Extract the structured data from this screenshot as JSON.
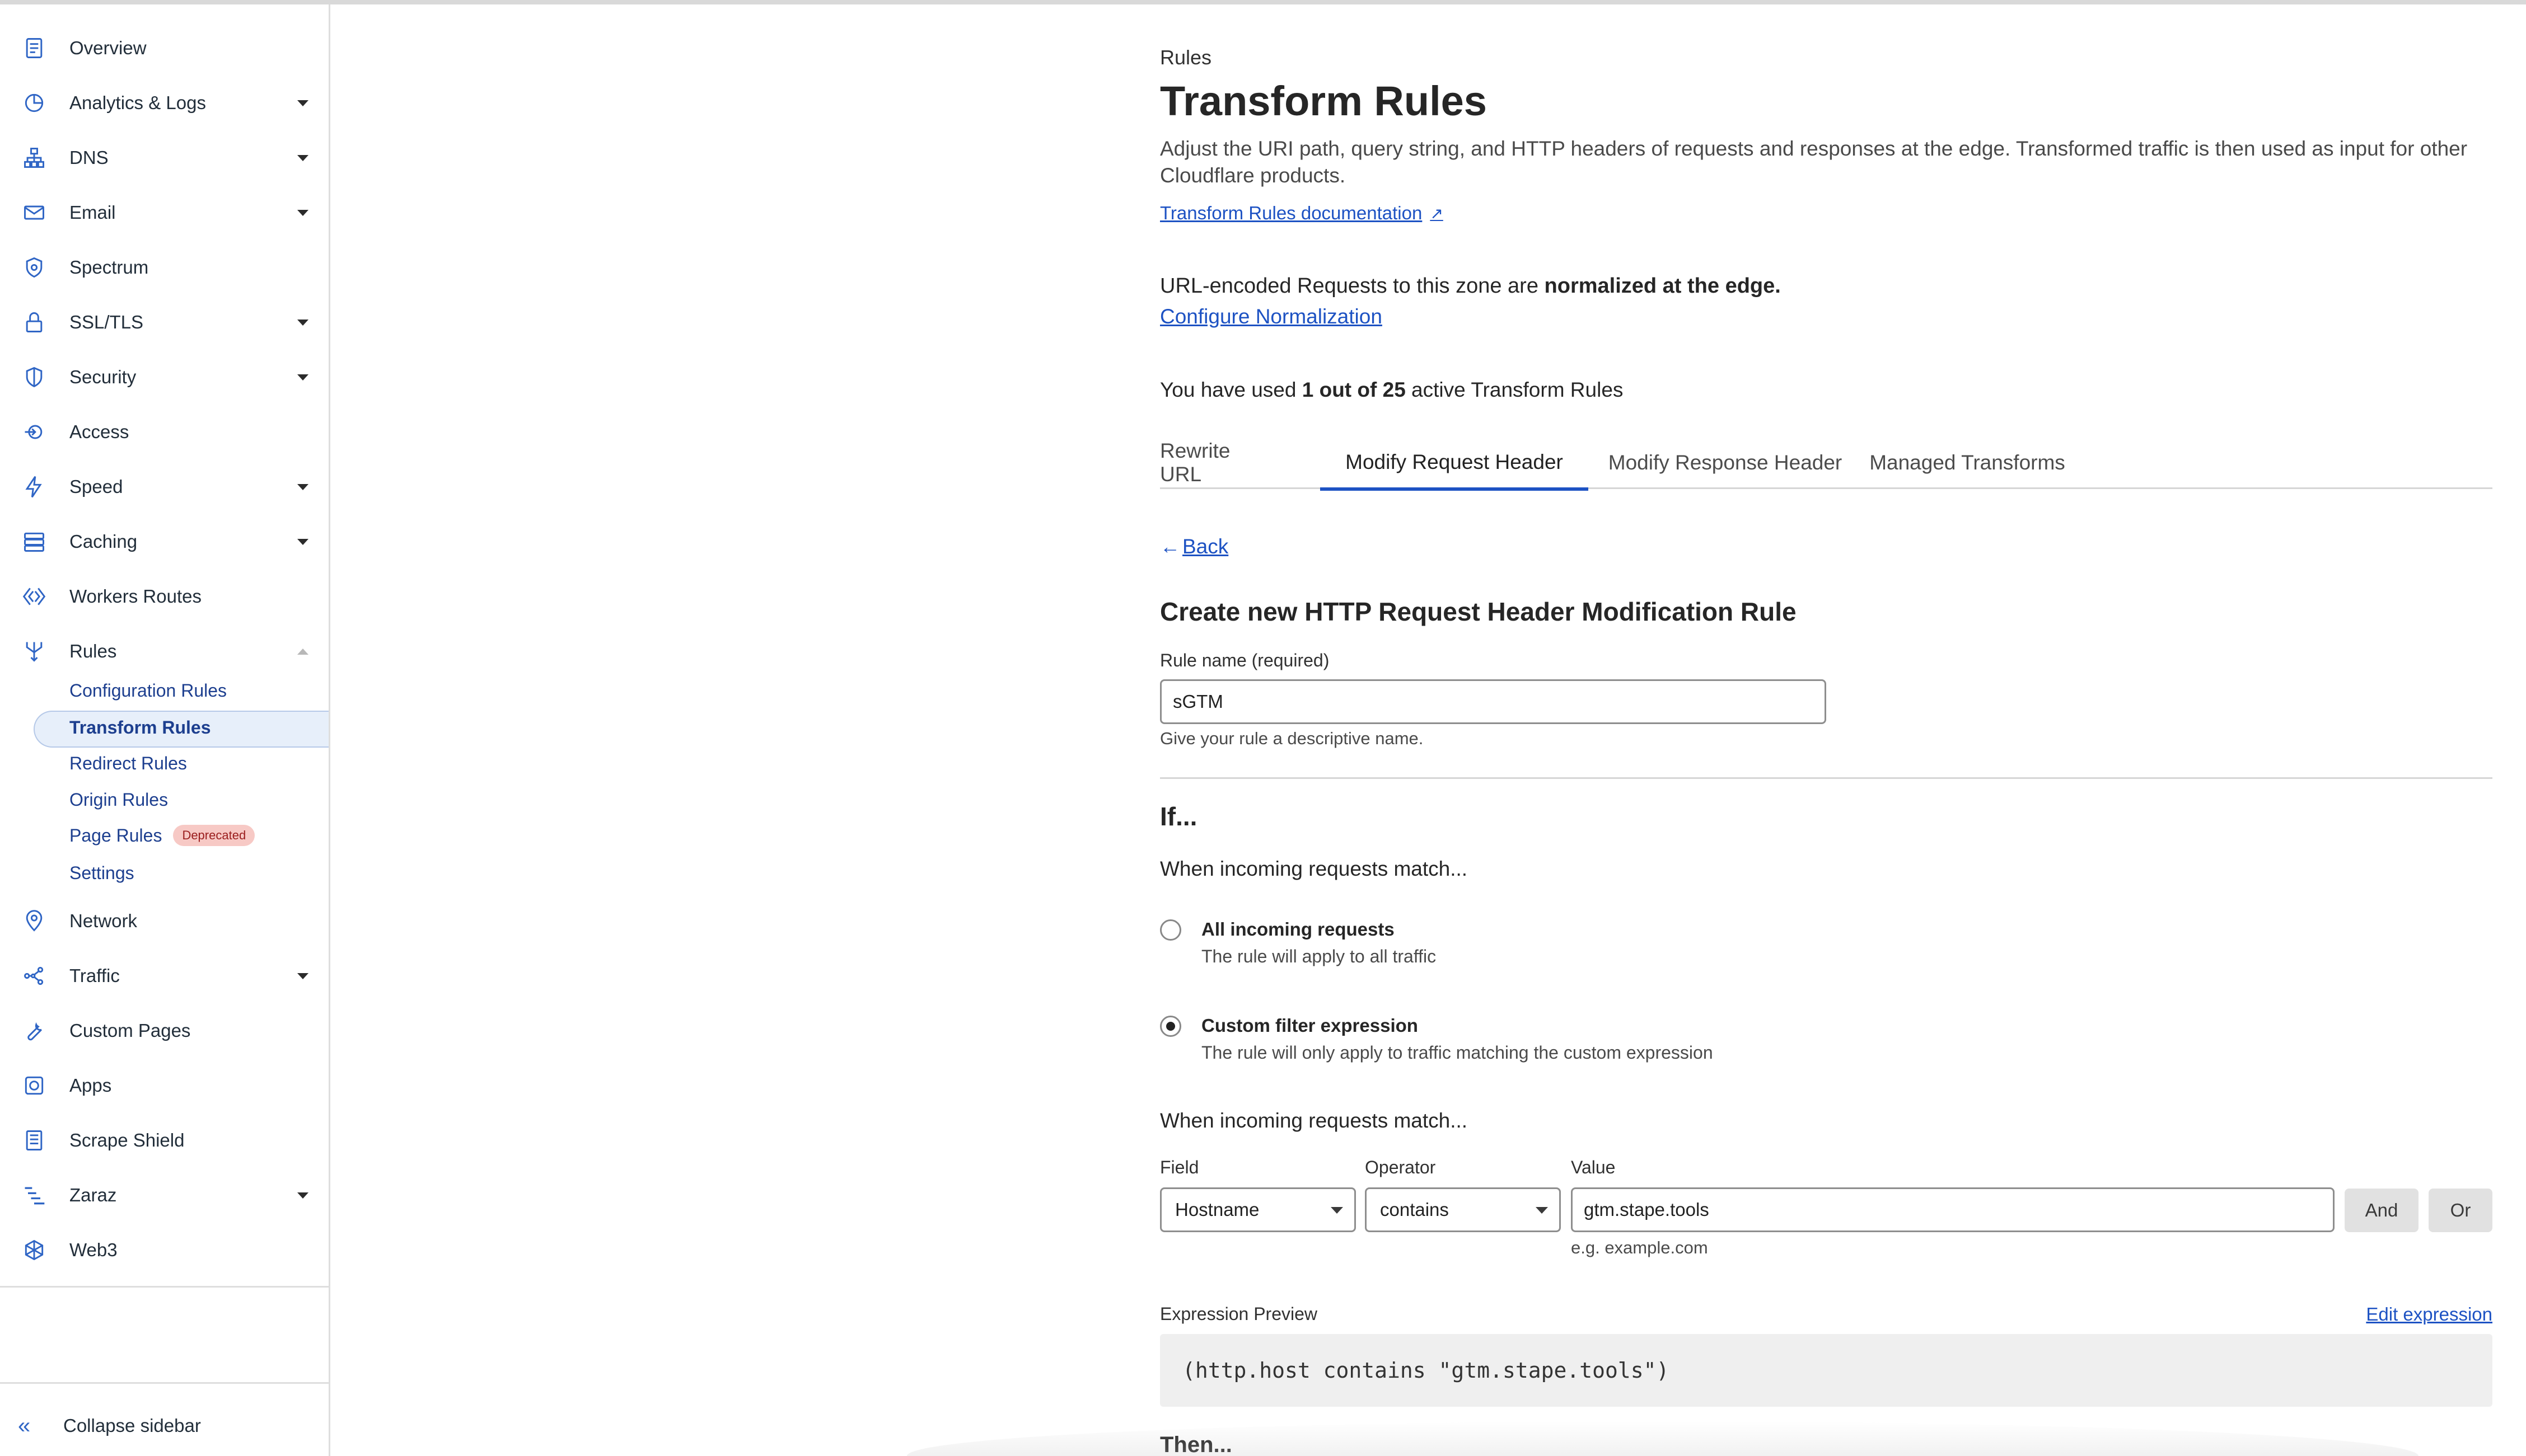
{
  "sidebar": {
    "items": [
      {
        "label": "Overview",
        "icon": "document-icon"
      },
      {
        "label": "Analytics & Logs",
        "icon": "pie-chart-icon"
      },
      {
        "label": "DNS",
        "icon": "network-tree-icon"
      },
      {
        "label": "Email",
        "icon": "envelope-icon"
      },
      {
        "label": "Spectrum",
        "icon": "shield-gear-icon"
      },
      {
        "label": "SSL/TLS",
        "icon": "lock-icon"
      },
      {
        "label": "Security",
        "icon": "shield-icon"
      },
      {
        "label": "Access",
        "icon": "access-loop-icon"
      },
      {
        "label": "Speed",
        "icon": "lightning-icon"
      },
      {
        "label": "Caching",
        "icon": "server-stack-icon"
      },
      {
        "label": "Workers Routes",
        "icon": "diamond-code-icon"
      },
      {
        "label": "Rules",
        "icon": "fork-icon"
      }
    ],
    "rules_subitems": [
      {
        "label": "Configuration Rules"
      },
      {
        "label": "Transform Rules"
      },
      {
        "label": "Redirect Rules"
      },
      {
        "label": "Origin Rules"
      },
      {
        "label": "Page Rules",
        "badge": "Deprecated"
      },
      {
        "label": "Settings"
      }
    ],
    "items_after": [
      {
        "label": "Network",
        "icon": "location-pin-icon"
      },
      {
        "label": "Traffic",
        "icon": "share-nodes-icon"
      },
      {
        "label": "Custom Pages",
        "icon": "wrench-icon"
      },
      {
        "label": "Apps",
        "icon": "apps-square-icon"
      },
      {
        "label": "Scrape Shield",
        "icon": "file-lines-icon"
      },
      {
        "label": "Zaraz",
        "icon": "zaraz-lines-icon"
      },
      {
        "label": "Web3",
        "icon": "web3-hex-icon"
      }
    ],
    "collapse_label": "Collapse sidebar"
  },
  "header": {
    "breadcrumb": "Rules",
    "title": "Transform Rules",
    "description": "Adjust the URI path, query string, and HTTP headers of requests and responses at the edge. Transformed traffic is then used as input for other Cloudflare products.",
    "doc_link": "Transform Rules documentation"
  },
  "normalization": {
    "text_prefix": "URL-encoded Requests to this zone are ",
    "text_bold": "normalized at the edge.",
    "link": "Configure Normalization"
  },
  "usage": {
    "prefix": "You have used ",
    "bold": "1 out of 25",
    "suffix": " active Transform Rules"
  },
  "tabs": [
    {
      "label": "Rewrite URL",
      "active": false
    },
    {
      "label": "Modify Request Header",
      "active": true
    },
    {
      "label": "Modify Response Header",
      "active": false
    },
    {
      "label": "Managed Transforms",
      "active": false
    }
  ],
  "form": {
    "back_label": "Back",
    "section_title": "Create new HTTP Request Header Modification Rule",
    "rule_name_label": "Rule name (required)",
    "rule_name_value": "sGTM",
    "rule_name_help": "Give your rule a descriptive name.",
    "if_title": "If...",
    "match_heading": "When incoming requests match...",
    "radio_all_title": "All incoming requests",
    "radio_all_desc": "The rule will apply to all traffic",
    "radio_custom_title": "Custom filter expression",
    "radio_custom_desc": "The rule will only apply to traffic matching the custom expression",
    "selected_radio": "custom",
    "match_heading_2": "When incoming requests match...",
    "field_label": "Field",
    "field_value": "Hostname",
    "operator_label": "Operator",
    "operator_value": "contains",
    "value_label": "Value",
    "value_value": "gtm.stape.tools",
    "value_help": "e.g. example.com",
    "and_label": "And",
    "or_label": "Or",
    "expression_preview_label": "Expression Preview",
    "edit_expression_label": "Edit expression",
    "expression": "(http.host contains \"gtm.stape.tools\")",
    "then_title": "Then..."
  },
  "colors": {
    "accent": "#1d52c3",
    "badge_bg": "#f7c9c5",
    "active_bg": "#e7effa"
  }
}
